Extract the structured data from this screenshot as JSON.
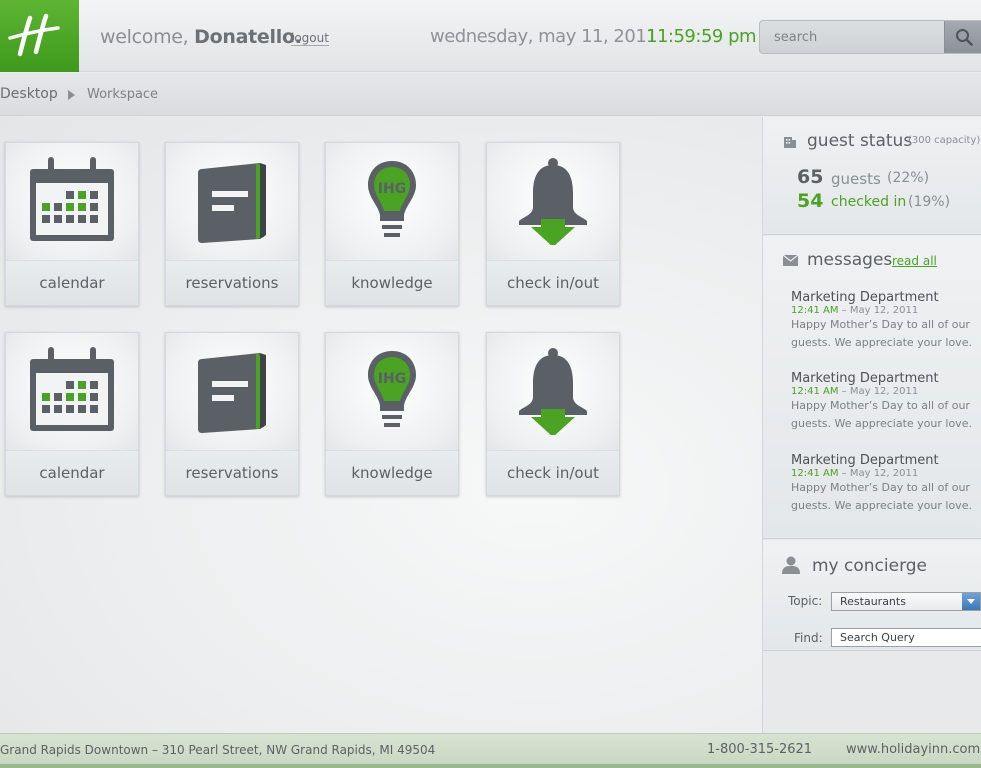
{
  "header": {
    "welcome_prefix": "welcome,",
    "user_name": "Donatello.",
    "logout_label": "logout",
    "date": "wednesday, may 11, 2011",
    "time": "11:59:59 pm",
    "search_placeholder": "search"
  },
  "breadcrumb": {
    "root": "Desktop",
    "current": "Workspace"
  },
  "tiles": [
    {
      "label": "calendar",
      "icon": "calendar-icon"
    },
    {
      "label": "reservations",
      "icon": "book-icon"
    },
    {
      "label": "knowledge",
      "icon": "lightbulb-icon"
    },
    {
      "label": "check in/out",
      "icon": "bell-icon"
    },
    {
      "label": "calendar",
      "icon": "calendar-icon"
    },
    {
      "label": "reservations",
      "icon": "book-icon"
    },
    {
      "label": "knowledge",
      "icon": "lightbulb-icon"
    },
    {
      "label": "check in/out",
      "icon": "bell-icon"
    }
  ],
  "guest_status": {
    "title": "guest status",
    "capacity": "(300 capacity)",
    "guests_count": "65",
    "guests_label": "guests",
    "guests_pct": "(22%)",
    "checked_count": "54",
    "checked_label": "checked in",
    "checked_pct": "(19%)"
  },
  "messages": {
    "title": "messages",
    "read_all_label": "read all",
    "items": [
      {
        "sender": "Marketing Department",
        "time": "12:41 AM",
        "date": "– May 12, 2011",
        "body": "Happy Mother’s Day to all of our guests. We appreciate your love."
      },
      {
        "sender": "Marketing Department",
        "time": "12:41 AM",
        "date": "– May 12, 2011",
        "body": "Happy Mother’s Day to all of our guests. We appreciate your love."
      },
      {
        "sender": "Marketing Department",
        "time": "12:41 AM",
        "date": "– May 12, 2011",
        "body": "Happy Mother’s Day to all of our guests. We appreciate your love."
      }
    ]
  },
  "concierge": {
    "title": "my concierge",
    "topic_label": "Topic:",
    "topic_value": "Restaurants",
    "find_label": "Find:",
    "find_placeholder": "Search Query"
  },
  "footer": {
    "address": "Grand Rapids Downtown  –  310 Pearl Street, NW Grand Rapids, MI 49504",
    "phone": "1-800-315-2621",
    "website": "www.holidayinn.com"
  },
  "colors": {
    "brand_green": "#4aa323",
    "icon_gray": "#5a6066"
  }
}
